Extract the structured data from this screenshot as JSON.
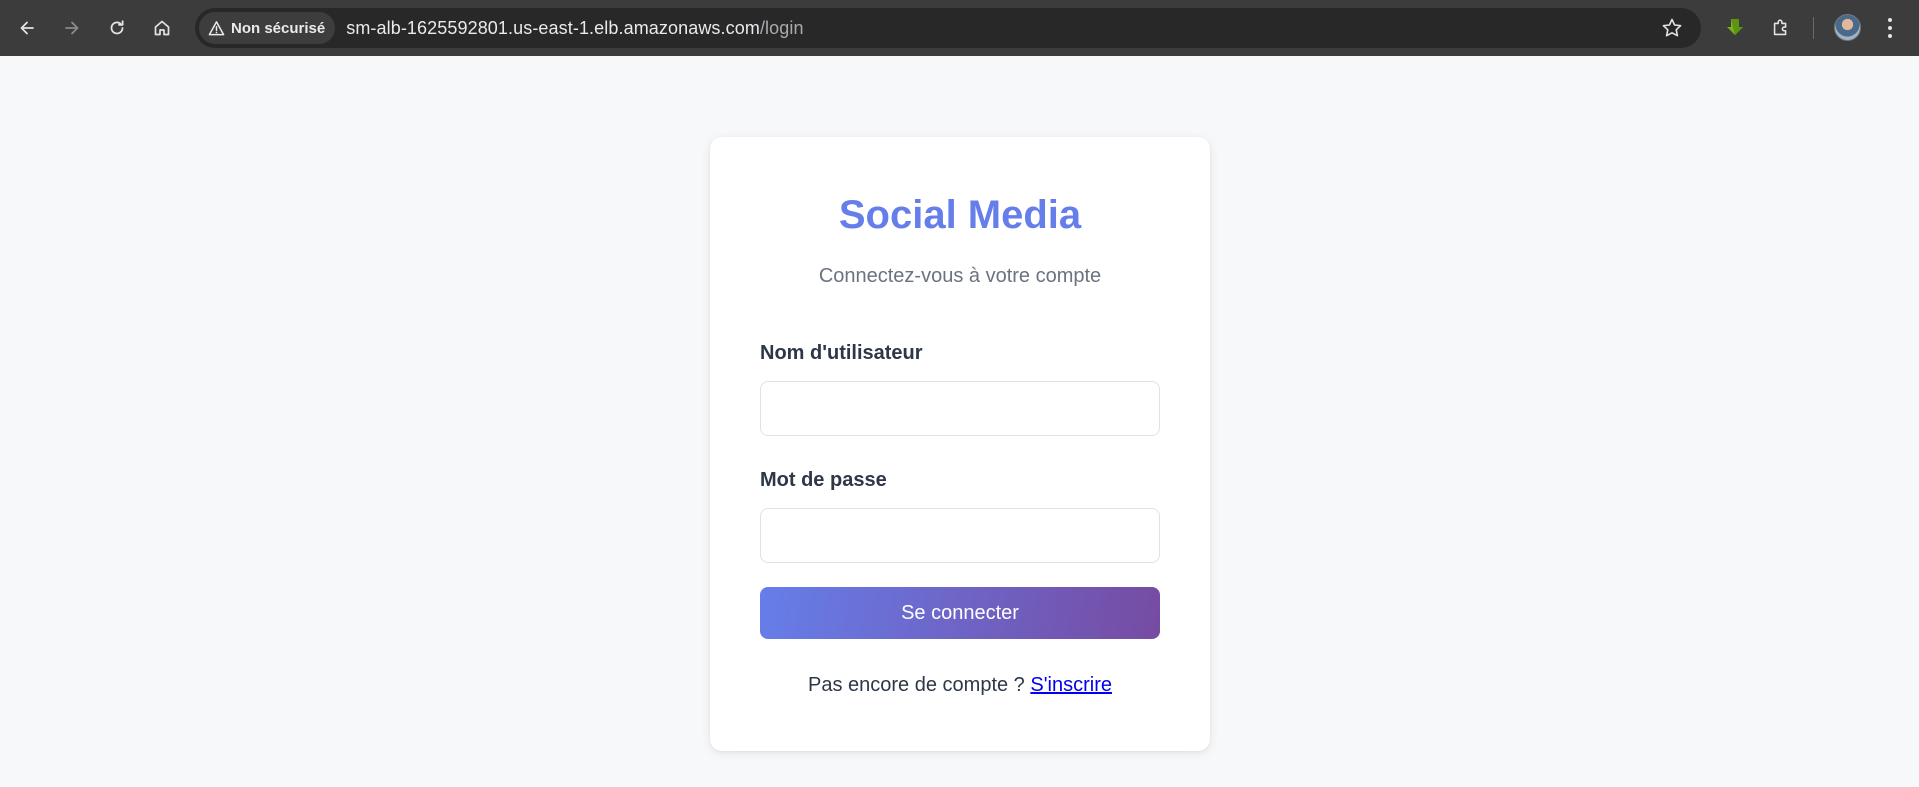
{
  "browser": {
    "security_label": "Non sécurisé",
    "url_host": "sm-alb-1625592801.us-east-1.elb.amazonaws.com",
    "url_path": "/login"
  },
  "login": {
    "title": "Social Media",
    "subtitle": "Connectez-vous à votre compte",
    "username_label": "Nom d'utilisateur",
    "username_value": "",
    "password_label": "Mot de passe",
    "password_value": "",
    "submit_label": "Se connecter",
    "signup_prompt": "Pas encore de compte ?",
    "signup_link": "S'inscrire"
  },
  "colors": {
    "accent": "#667eea",
    "button_gradient_start": "#667eea",
    "button_gradient_end": "#764ba2",
    "chrome_bg": "#3c3c3c",
    "page_bg": "#f7f8fa"
  },
  "icons": {
    "back": "arrow-left-icon",
    "forward": "arrow-right-icon",
    "reload": "reload-icon",
    "home": "home-icon",
    "warning": "warning-triangle-icon",
    "bookmark": "star-icon",
    "download": "download-arrow-icon",
    "extensions": "puzzle-icon",
    "menu": "kebab-menu-icon"
  }
}
